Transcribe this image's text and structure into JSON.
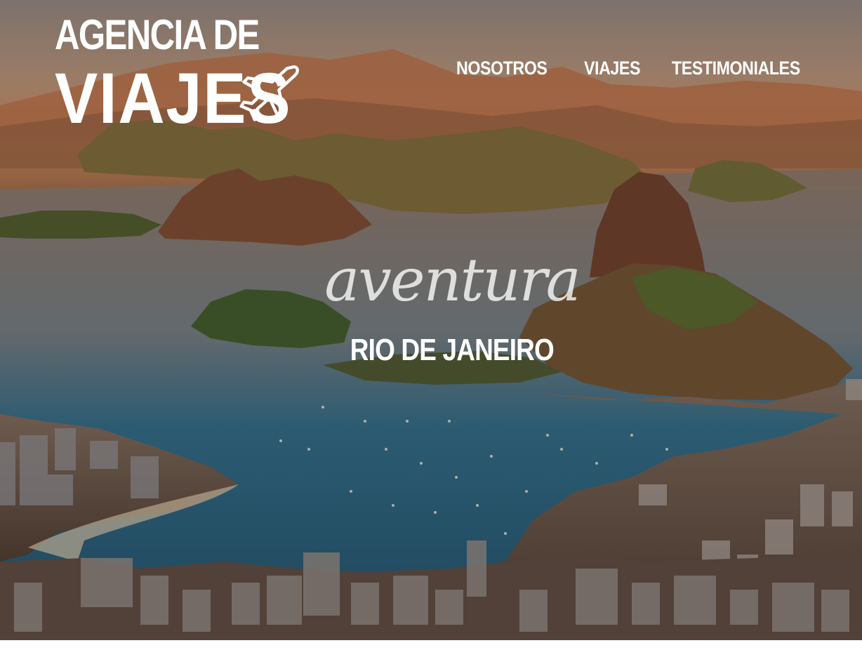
{
  "logo": {
    "line1": "AGENCIA DE",
    "line2": "VIAJES",
    "icon": "airplane-icon"
  },
  "nav": {
    "items": [
      {
        "label": "NOSOTROS"
      },
      {
        "label": "VIAJES"
      },
      {
        "label": "TESTIMONIALES"
      }
    ]
  },
  "hero": {
    "tagline": "aventura",
    "destination": "RIO DE JANEIRO"
  },
  "colors": {
    "overlay": "#3a2a20",
    "sky": "#c89a6a",
    "water": "#1f5a78",
    "mountain": "#5a3a26",
    "text": "#ffffff"
  }
}
